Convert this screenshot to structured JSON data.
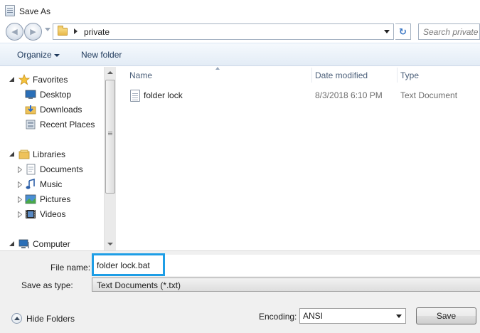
{
  "window": {
    "title": "Save As"
  },
  "address": {
    "path": [
      "private"
    ],
    "search_placeholder": "Search private"
  },
  "toolbar": {
    "organize_label": "Organize",
    "new_folder_label": "New folder"
  },
  "nav": {
    "favorites": {
      "label": "Favorites",
      "items": [
        {
          "label": "Desktop",
          "icon": "desktop-icon"
        },
        {
          "label": "Downloads",
          "icon": "downloads-icon"
        },
        {
          "label": "Recent Places",
          "icon": "recent-places-icon"
        }
      ]
    },
    "libraries": {
      "label": "Libraries",
      "items": [
        {
          "label": "Documents",
          "icon": "documents-icon"
        },
        {
          "label": "Music",
          "icon": "music-icon"
        },
        {
          "label": "Pictures",
          "icon": "pictures-icon"
        },
        {
          "label": "Videos",
          "icon": "videos-icon"
        }
      ]
    },
    "computer": {
      "label": "Computer"
    }
  },
  "filelist": {
    "columns": [
      "Name",
      "Date modified",
      "Type"
    ],
    "rows": [
      {
        "name": "folder lock",
        "date": "8/3/2018 6:10 PM",
        "type": "Text Document",
        "icon": "text-document-icon"
      }
    ]
  },
  "form": {
    "file_name_label": "File name:",
    "file_name_value": "folder lock.bat",
    "save_as_type_label": "Save as type:",
    "save_as_type_value": "Text Documents (*.txt)",
    "encoding_label": "Encoding:",
    "encoding_value": "ANSI",
    "hide_folders_label": "Hide Folders",
    "save_label": "Save"
  },
  "colors": {
    "highlight_border": "#1e9ee6",
    "command_text": "#1e395b",
    "header_text": "#4c607a"
  }
}
